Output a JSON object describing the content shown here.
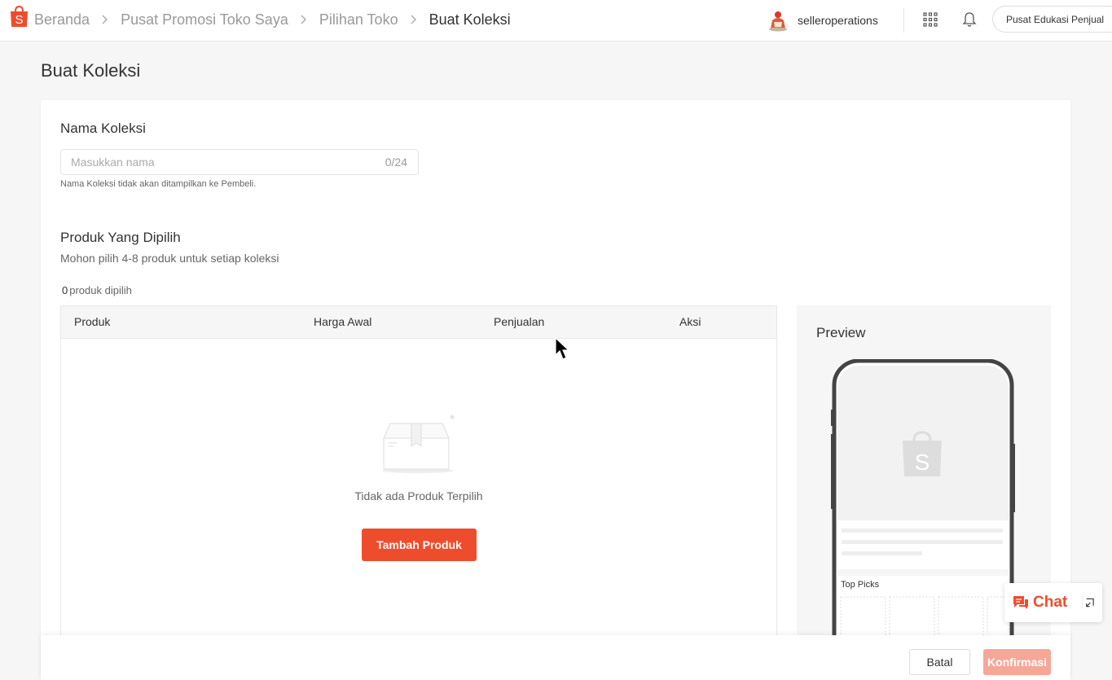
{
  "header": {
    "breadcrumbs": [
      "Beranda",
      "Pusat Promosi Toko Saya",
      "Pilihan Toko",
      "Buat Koleksi"
    ],
    "username": "selleroperations",
    "education_button": "Pusat Edukasi Penjual"
  },
  "page": {
    "title": "Buat Koleksi"
  },
  "collection_name": {
    "title": "Nama Koleksi",
    "placeholder": "Masukkan nama",
    "value": "",
    "counter": "0/24",
    "hint": "Nama Koleksi tidak akan ditampilkan ke Pembeli."
  },
  "products": {
    "title": "Produk Yang Dipilih",
    "subtitle": "Mohon pilih 4-8 produk untuk setiap koleksi",
    "selected_count": "0",
    "selected_suffix": "produk dipilih",
    "columns": [
      "Produk",
      "Harga Awal",
      "Penjualan",
      "Aksi"
    ],
    "empty_text": "Tidak ada Produk Terpilih",
    "add_button": "Tambah Produk"
  },
  "preview": {
    "title": "Preview",
    "top_picks_label": "Top Picks"
  },
  "footer": {
    "cancel_label": "Batal",
    "confirm_label": "Konfirmasi"
  },
  "chat": {
    "label": "Chat"
  },
  "colors": {
    "brand": "#ee4d2d",
    "brand_disabled": "#f6a798"
  }
}
